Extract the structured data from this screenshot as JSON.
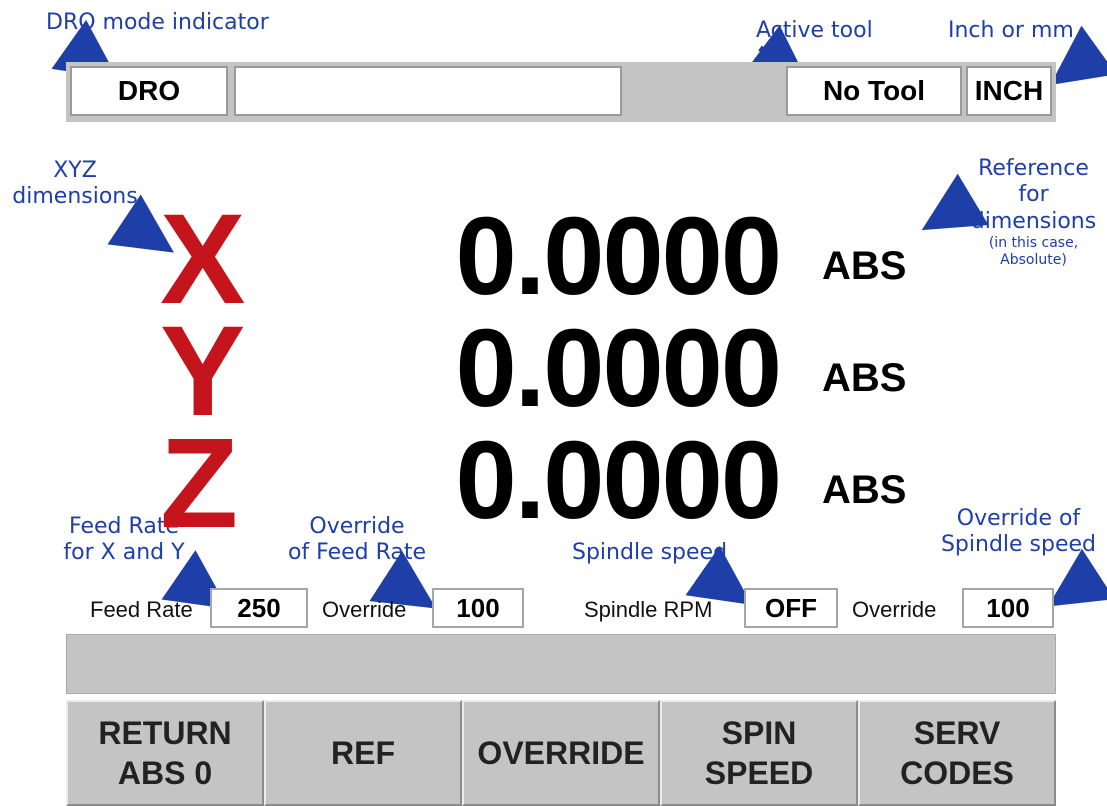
{
  "annotations": {
    "dro_mode": "DRO mode indicator",
    "active_tool": "Active tool",
    "inch_mm": "Inch or mm",
    "xyz_line1": "XYZ",
    "xyz_line2": "dimensions",
    "ref_line1": "Reference",
    "ref_line2": "for",
    "ref_line3": "dimensions",
    "ref_note1": "(in this case,",
    "ref_note2": "Absolute)",
    "feed_line1": "Feed Rate",
    "feed_line2": "for X and Y",
    "override_feed_line1": "Override",
    "override_feed_line2": "of Feed Rate",
    "spindle_speed": "Spindle speed",
    "override_spindle_line1": "Override of",
    "override_spindle_line2": "Spindle speed"
  },
  "status": {
    "mode": "DRO",
    "message": "",
    "tool": "No Tool",
    "units": "INCH"
  },
  "axes": [
    {
      "letter": "X",
      "value": "0.0000",
      "ref": "ABS"
    },
    {
      "letter": "Y",
      "value": "0.0000",
      "ref": "ABS"
    },
    {
      "letter": "Z",
      "value": "0.0000",
      "ref": "ABS"
    }
  ],
  "readouts": {
    "feed_label": "Feed Rate",
    "feed_value": "250",
    "feed_override_label": "Override",
    "feed_override_value": "100",
    "spindle_label": "Spindle RPM",
    "spindle_value": "OFF",
    "spindle_override_label": "Override",
    "spindle_override_value": "100"
  },
  "message_bar": "",
  "softkeys": [
    {
      "line1": "RETURN",
      "line2": "ABS 0"
    },
    {
      "line1": "REF",
      "line2": ""
    },
    {
      "line1": "OVERRIDE",
      "line2": ""
    },
    {
      "line1": "SPIN",
      "line2": "SPEED"
    },
    {
      "line1": "SERV",
      "line2": "CODES"
    }
  ],
  "colors": {
    "annotation": "#1f3fa8",
    "axis_letter": "#c4141c",
    "panel_gray": "#c4c4c4"
  }
}
